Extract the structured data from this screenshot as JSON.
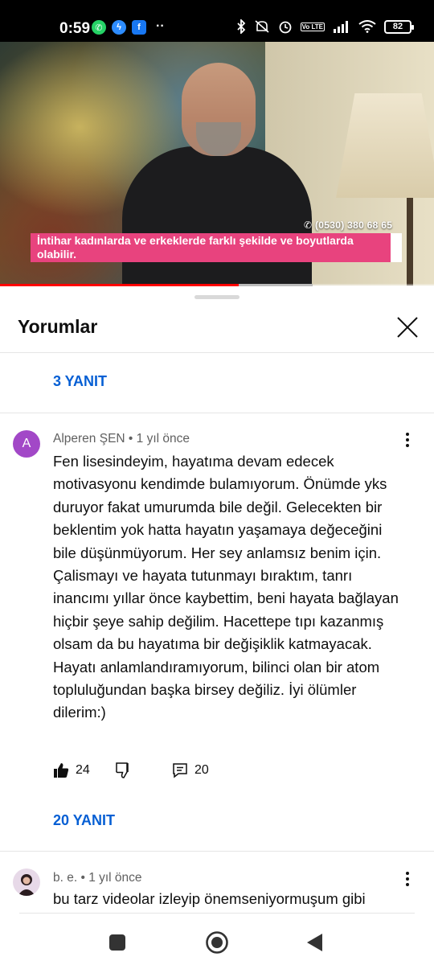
{
  "status_bar": {
    "time": "0:59",
    "battery": "82",
    "network_label": "Vo LTE"
  },
  "video": {
    "phone": "(0530) 380 68 65",
    "caption": "İntihar kadınlarda ve erkeklerde farklı şekilde ve boyutlarda olabilir.",
    "progress_fraction": 0.55,
    "buffer_fraction": 0.72
  },
  "sheet": {
    "title": "Yorumlar",
    "top_replies": "3 YANIT"
  },
  "comments": [
    {
      "avatar_letter": "A",
      "author": "Alperen ŞEN",
      "time": "1 yıl önce",
      "meta": "Alperen ŞEN • 1 yıl önce",
      "text": "Fen lisesindeyim, hayatıma devam edecek motivasyonu kendimde bulamıyorum. Önümde yks duruyor fakat umurumda bile değil. Gelecekten bir beklentim yok hatta hayatın yaşamaya değeceğini bile düşünmüyorum. Her sey anlamsız benim için. Çalismayı ve hayata tutunmayı bıraktım, tanrı inancımı yıllar önce kaybettim, beni hayata bağlayan hiçbir şeye sahip değilim. Hacettepe tıpı kazanmış olsam da bu hayatıma bir değişiklik katmayacak. Hayatı anlamlandıramıyorum, bilinci olan bir atom topluluğundan başka birsey değiliz. İyi ölümler dilerim:)",
      "likes": "24",
      "replies_count": "20",
      "replies_link": "20 YANIT"
    },
    {
      "author": "b. e.",
      "time": "1 yıl önce",
      "meta": "b. e. • 1 yıl önce",
      "text": "bu tarz videolar izleyip önemseniyormuşum gibi"
    }
  ],
  "colors": {
    "link_blue": "#065fd4",
    "caption_pink": "#e8437e",
    "progress_red": "#ff0000",
    "avatar_purple": "#a248c7"
  }
}
